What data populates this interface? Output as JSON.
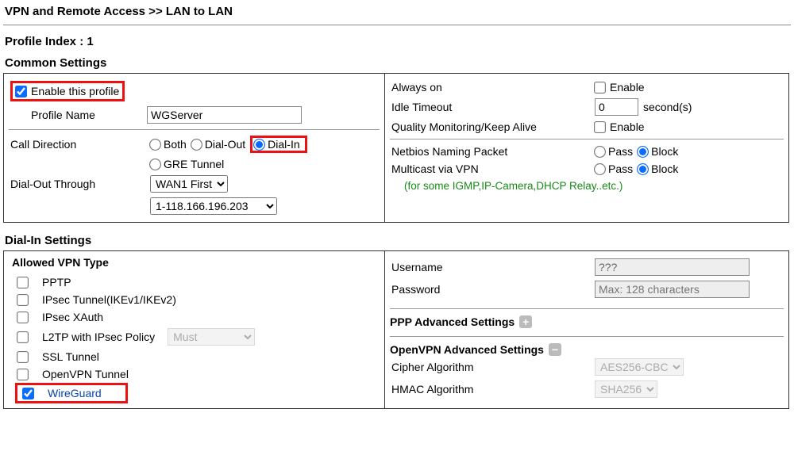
{
  "breadcrumb": "VPN and Remote Access >> LAN to LAN",
  "profile_index_label": "Profile Index : 1",
  "section_common": "Common Settings",
  "section_dialin": "Dial-In Settings",
  "common": {
    "enable_label": "Enable this profile",
    "enable_checked": true,
    "profile_name_label": "Profile Name",
    "profile_name_value": "WGServer",
    "call_direction_label": "Call Direction",
    "cd_both": "Both",
    "cd_dial_out": "Dial-Out",
    "cd_dial_in": "Dial-In",
    "cd_gre": "GRE Tunnel",
    "dial_out_through_label": "Dial-Out Through",
    "wan_select": "WAN1 First",
    "ip_select": "1-118.166.196.203"
  },
  "right": {
    "always_on": "Always on",
    "enable": "Enable",
    "idle_timeout": "Idle Timeout",
    "idle_value": "0",
    "seconds": "second(s)",
    "qmka": "Quality Monitoring/Keep Alive",
    "netbios": "Netbios Naming Packet",
    "multicast": "Multicast via VPN",
    "pass": "Pass",
    "block": "Block",
    "green": "(for some IGMP,IP-Camera,DHCP Relay..etc.)"
  },
  "dialin": {
    "allowed_header": "Allowed VPN Type",
    "types": {
      "pptp": "PPTP",
      "ipsec": "IPsec Tunnel(IKEv1/IKEv2)",
      "xauth": "IPsec XAuth",
      "l2tp": "L2TP with IPsec Policy",
      "l2tp_select": "Must",
      "ssl": "SSL Tunnel",
      "openvpn": "OpenVPN Tunnel",
      "wireguard": "WireGuard"
    },
    "username_label": "Username",
    "username_value": "???",
    "password_label": "Password",
    "password_placeholder": "Max: 128 characters",
    "ppp_adv": "PPP Advanced Settings",
    "ovpn_adv": "OpenVPN Advanced Settings",
    "cipher_label": "Cipher Algorithm",
    "cipher_value": "AES256-CBC",
    "hmac_label": "HMAC Algorithm",
    "hmac_value": "SHA256"
  }
}
